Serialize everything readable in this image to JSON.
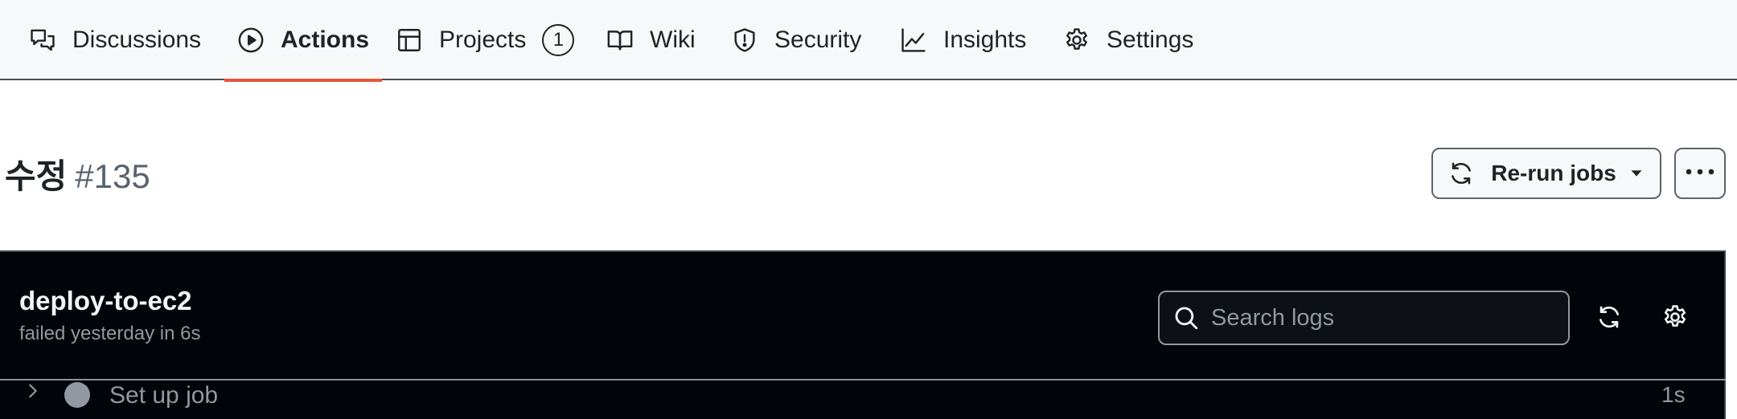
{
  "nav": {
    "tabs": [
      {
        "label": "Discussions",
        "icon": "comment-discussion-icon",
        "active": false
      },
      {
        "label": "Actions",
        "icon": "play-icon",
        "active": true
      },
      {
        "label": "Projects",
        "icon": "table-icon",
        "active": false,
        "counter": "1"
      },
      {
        "label": "Wiki",
        "icon": "book-icon",
        "active": false
      },
      {
        "label": "Security",
        "icon": "shield-icon",
        "active": false
      },
      {
        "label": "Insights",
        "icon": "graph-icon",
        "active": false
      },
      {
        "label": "Settings",
        "icon": "gear-icon",
        "active": false
      }
    ]
  },
  "run": {
    "title": "수정",
    "number": "#135",
    "rerun_label": "Re-run jobs",
    "more_label": "..."
  },
  "job": {
    "name": "deploy-to-ec2",
    "status": "failed yesterday in 6s",
    "search_placeholder": "Search logs",
    "steps": [
      {
        "name": "Set up job",
        "duration": "1s"
      }
    ]
  },
  "colors": {
    "accent_underline": "#e6563b",
    "panel_background": "#010409",
    "nav_background": "#f6f8fa"
  }
}
